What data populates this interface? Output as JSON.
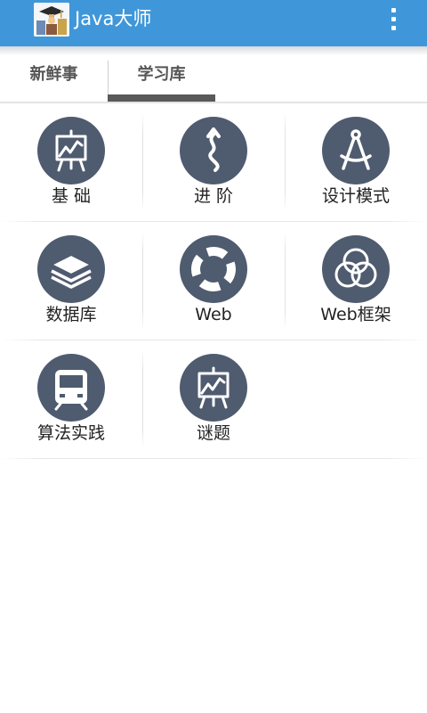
{
  "app": {
    "title": "Java大师",
    "icon": "app-logo-icon",
    "menu_icon": "overflow-menu-icon",
    "colors": {
      "action_bar": "#3f97d9",
      "tile": "#4f5b6f"
    }
  },
  "tabs": [
    {
      "label": "新鲜事",
      "selected": false
    },
    {
      "label": "学习库",
      "selected": true
    }
  ],
  "grid": [
    {
      "label": "基 础",
      "icon": "chart-easel-icon"
    },
    {
      "label": "进 阶",
      "icon": "winding-road-icon"
    },
    {
      "label": "设计模式",
      "icon": "compass-drafting-icon"
    },
    {
      "label": "数据库",
      "icon": "layers-icon"
    },
    {
      "label": "Web",
      "icon": "lifebuoy-icon"
    },
    {
      "label": "Web框架",
      "icon": "rings-icon"
    },
    {
      "label": "算法实践",
      "icon": "train-icon"
    },
    {
      "label": "谜题",
      "icon": "chart-easel-icon"
    }
  ]
}
